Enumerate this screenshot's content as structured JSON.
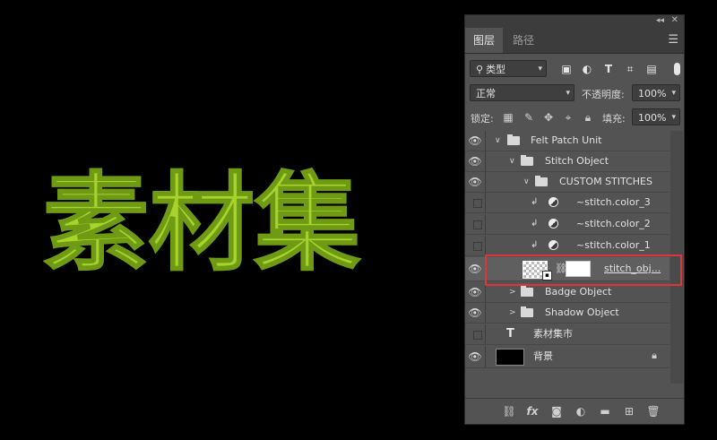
{
  "canvas": {
    "art_text": "素材集",
    "colors": {
      "fill": "#a8d22c",
      "edge": "#6f9a14",
      "background": "#000000"
    }
  },
  "panel": {
    "tabs": [
      {
        "label": "图层",
        "active": true
      },
      {
        "label": "路径",
        "active": false
      }
    ],
    "filter": {
      "kind_label": "类型",
      "icons": [
        "image-filter-icon",
        "adjustment-filter-icon",
        "type-filter-icon",
        "shape-filter-icon",
        "smart-object-filter-icon"
      ]
    },
    "blend": {
      "mode": "正常",
      "opacity_label": "不透明度:",
      "opacity_value": "100%"
    },
    "lock": {
      "label": "锁定:",
      "fill_label": "填充:",
      "fill_value": "100%"
    },
    "layers": [
      {
        "name": "Felt Patch Unit",
        "type": "group",
        "visible": true,
        "expanded": true,
        "indent": 0
      },
      {
        "name": "Stitch Object",
        "type": "group",
        "visible": true,
        "expanded": true,
        "indent": 1
      },
      {
        "name": "CUSTOM STITCHES",
        "type": "group",
        "visible": true,
        "expanded": true,
        "indent": 2
      },
      {
        "name": "~stitch.color_3",
        "type": "adjustment",
        "visible": false,
        "clipped": true
      },
      {
        "name": "~stitch.color_2",
        "type": "adjustment",
        "visible": false,
        "clipped": true
      },
      {
        "name": "~stitch.color_1",
        "type": "adjustment",
        "visible": false,
        "clipped": true
      },
      {
        "name": "stitch_obj...",
        "type": "smart-object",
        "visible": true,
        "selected": true
      },
      {
        "name": "Badge Object",
        "type": "group",
        "visible": true,
        "expanded": false,
        "indent": 1
      },
      {
        "name": "Shadow Object",
        "type": "group",
        "visible": true,
        "expanded": false,
        "indent": 1
      },
      {
        "name": "素材集市",
        "type": "text",
        "visible": false
      },
      {
        "name": "背景",
        "type": "background",
        "visible": true,
        "locked": true
      }
    ],
    "highlight_color": "#e0343a"
  }
}
